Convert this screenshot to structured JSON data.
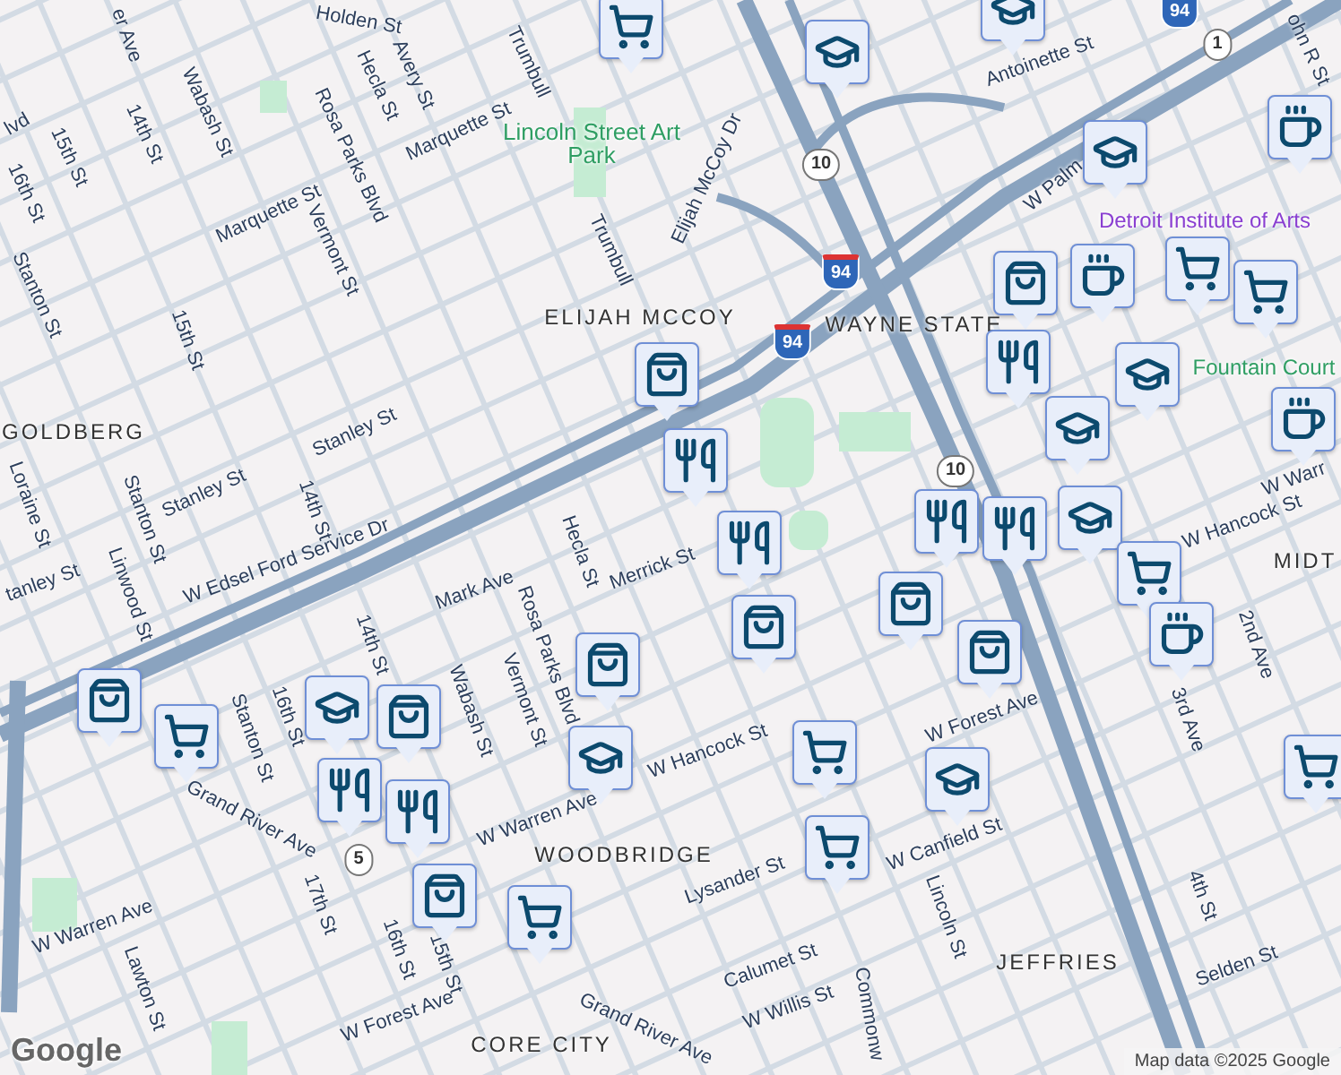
{
  "map": {
    "neighborhoods": [
      "ELIJAH MCCOY",
      "GOLDBERG",
      "WAYNE STATE",
      "WOODBRIDGE",
      "JEFFRIES",
      "CORE CITY",
      "MIDT"
    ],
    "parks": [
      "Lincoln Street Art Park",
      "Fountain Court"
    ],
    "landmarks": [
      "Detroit Institute of Arts"
    ],
    "streets": [
      "Holden St",
      "er Ave",
      "lvd",
      "16th St",
      "15th St",
      "14th St",
      "Wabash St",
      "Rosa Parks Blvd",
      "Hecla St",
      "Avery St",
      "Trumbull",
      "Marquette St",
      "Marquette St",
      "Vermont St",
      "Trumbull",
      "Stanton St",
      "15th St",
      "Stanley St",
      "Stanley St",
      "Loraine St",
      "Stanton St",
      "14th St",
      "Elijah McCoy Dr",
      "Antoinette St",
      "W Palm",
      "ohn R St",
      "W Warr",
      "W Hancock St",
      "tanley St",
      "Linwood St",
      "W Edsel Ford Service Dr",
      "Mark Ave",
      "Hecla St",
      "Merrick St",
      "Rosa Parks Blvd",
      "Vermont St",
      "14th St",
      "Wabash St",
      "Stanton St",
      "16th St",
      "Grand River Ave",
      "W Warren Ave",
      "W Hancock St",
      "W Forest Ave",
      "W Canfield St",
      "Lysander St",
      "Lincoln St",
      "Calumet St",
      "W Willis St",
      "17th St",
      "16th St",
      "15th St",
      "W Forest Ave",
      "Lawton St",
      "W Warren Ave",
      "Selden St",
      "4th St",
      "2nd Ave",
      "3rd Ave",
      "Grand River Ave",
      "Commonw"
    ],
    "route_shields": [
      {
        "label": "10",
        "kind": "state"
      },
      {
        "label": "10",
        "kind": "state"
      },
      {
        "label": "94",
        "kind": "interstate"
      },
      {
        "label": "94",
        "kind": "interstate"
      },
      {
        "label": "94",
        "kind": "interstate"
      },
      {
        "label": "1",
        "kind": "state"
      },
      {
        "label": "5",
        "kind": "state"
      }
    ]
  },
  "markers": [
    {
      "kind": "grocery"
    },
    {
      "kind": "school"
    },
    {
      "kind": "school"
    },
    {
      "kind": "cafe"
    },
    {
      "kind": "school"
    },
    {
      "kind": "cafe"
    },
    {
      "kind": "shopping"
    },
    {
      "kind": "grocery"
    },
    {
      "kind": "grocery"
    },
    {
      "kind": "school"
    },
    {
      "kind": "restaurant"
    },
    {
      "kind": "shopping"
    },
    {
      "kind": "restaurant"
    },
    {
      "kind": "school"
    },
    {
      "kind": "cafe"
    },
    {
      "kind": "school"
    },
    {
      "kind": "restaurant"
    },
    {
      "kind": "restaurant"
    },
    {
      "kind": "restaurant"
    },
    {
      "kind": "grocery"
    },
    {
      "kind": "shopping"
    },
    {
      "kind": "shopping"
    },
    {
      "kind": "cafe"
    },
    {
      "kind": "shopping"
    },
    {
      "kind": "shopping"
    },
    {
      "kind": "grocery"
    },
    {
      "kind": "shopping"
    },
    {
      "kind": "shopping"
    },
    {
      "kind": "school"
    },
    {
      "kind": "restaurant"
    },
    {
      "kind": "restaurant"
    },
    {
      "kind": "school"
    },
    {
      "kind": "grocery"
    },
    {
      "kind": "school"
    },
    {
      "kind": "grocery"
    },
    {
      "kind": "grocery"
    },
    {
      "kind": "shopping"
    },
    {
      "kind": "grocery"
    }
  ],
  "attribution": {
    "logo": "Google",
    "text": "Map data ©2025 Google"
  }
}
